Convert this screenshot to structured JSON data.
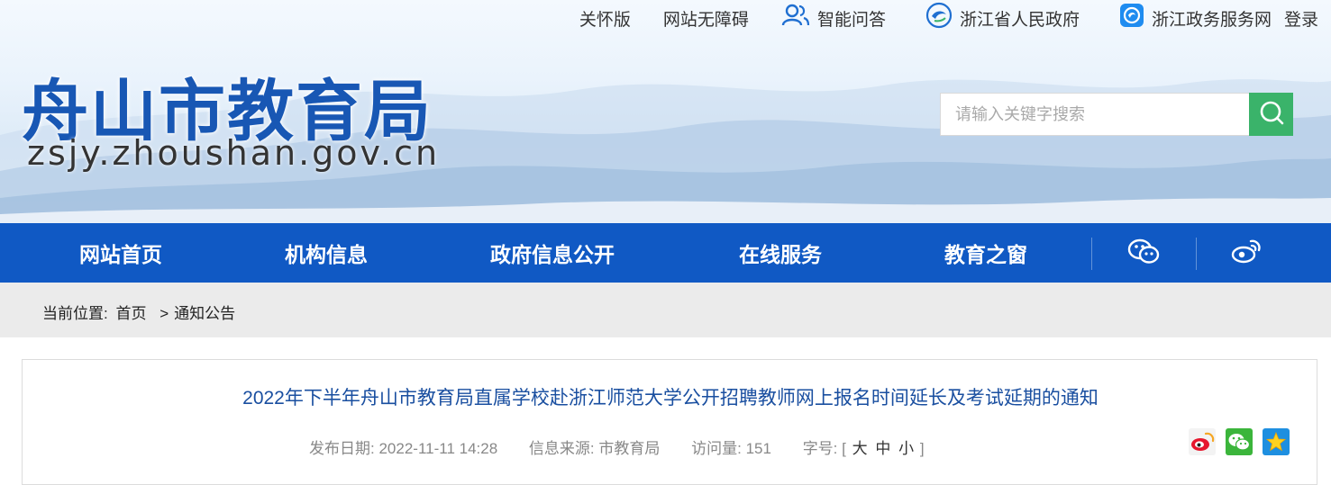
{
  "top_links": {
    "care": "关怀版",
    "accessibility": "网站无障碍",
    "qa": "智能问答",
    "province_gov": "浙江省人民政府",
    "service_net": "浙江政务服务网",
    "login": "登录"
  },
  "logo": {
    "name": "舟山市教育局",
    "url": "zsjy.zhoushan.gov.cn"
  },
  "search": {
    "placeholder": "请输入关键字搜索",
    "icon": "search-icon"
  },
  "nav": {
    "items": [
      "网站首页",
      "机构信息",
      "政府信息公开",
      "在线服务",
      "教育之窗"
    ],
    "icons": [
      "wechat-icon",
      "weibo-icon"
    ]
  },
  "breadcrumb": {
    "label": "当前位置:",
    "home": "首页",
    "separator": ">",
    "current": "通知公告"
  },
  "article": {
    "title": "2022年下半年舟山市教育局直属学校赴浙江师范大学公开招聘教师网上报名时间延长及考试延期的通知",
    "date_label": "发布日期:",
    "date": "2022-11-11 14:28",
    "source_label": "信息来源:",
    "source": "市教育局",
    "views_label": "访问量:",
    "views": "151",
    "fontsize_label": "字号:",
    "fontsize_open": "[",
    "fontsize_large": "大",
    "fontsize_medium": "中",
    "fontsize_small": "小",
    "fontsize_close": "]",
    "share_icons": [
      "weibo-share-icon",
      "wechat-share-icon",
      "qzone-share-icon"
    ]
  },
  "colors": {
    "nav_bg": "#1059c4",
    "logo": "#1857b4",
    "search_button": "#3ab36a",
    "title": "#1a4fa0",
    "breadcrumb_bg": "#ebebeb"
  }
}
